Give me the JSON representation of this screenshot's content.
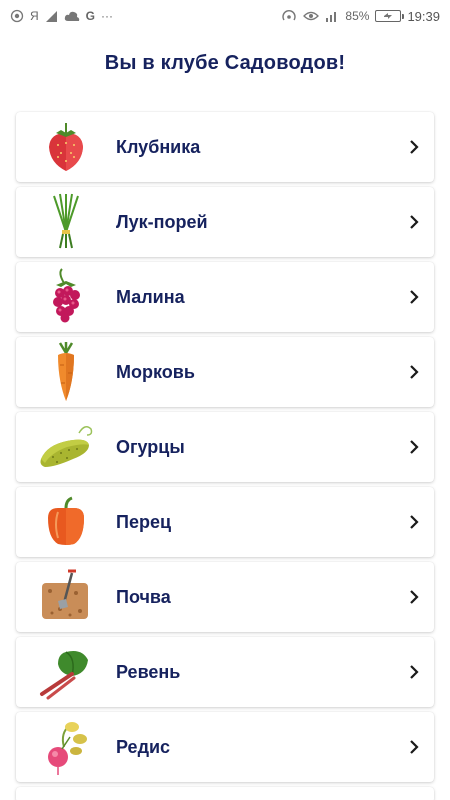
{
  "status_bar": {
    "left_icons": [
      "wifi-calling-icon",
      "yandex-icon",
      "send-icon",
      "cloud-icon",
      "google-icon",
      "more-dots-icon"
    ],
    "yandex_glyph": "Я",
    "google_glyph": "G",
    "more_glyph": "···",
    "battery_percent": "85%",
    "time": "19:39"
  },
  "page": {
    "title": "Вы в клубе Садоводов!"
  },
  "items": [
    {
      "label": "Клубника",
      "icon": "strawberry-icon"
    },
    {
      "label": "Лук-порей",
      "icon": "leek-icon"
    },
    {
      "label": "Малина",
      "icon": "raspberry-icon"
    },
    {
      "label": "Морковь",
      "icon": "carrot-icon"
    },
    {
      "label": "Огурцы",
      "icon": "cucumber-icon"
    },
    {
      "label": "Перец",
      "icon": "pepper-icon"
    },
    {
      "label": "Почва",
      "icon": "soil-icon"
    },
    {
      "label": "Ревень",
      "icon": "rhubarb-icon"
    },
    {
      "label": "Редис",
      "icon": "radish-icon"
    }
  ],
  "colors": {
    "title": "#16225e",
    "chevron": "#1a1a1a"
  }
}
